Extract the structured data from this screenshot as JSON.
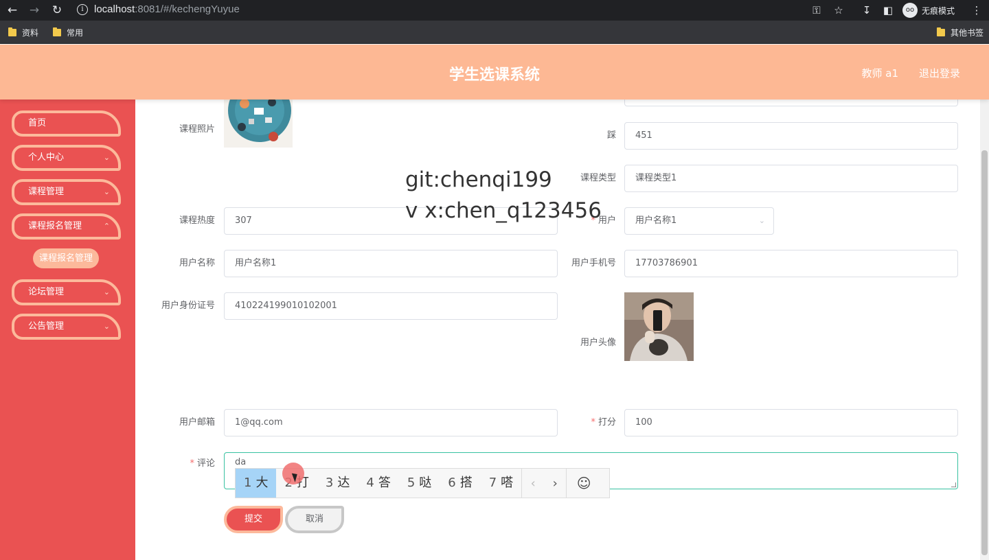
{
  "browser": {
    "url_host": "localhost",
    "url_rest": ":8081/#/kechengYuyue",
    "incognito_label": "无痕模式",
    "bookmarks": [
      {
        "label": "资料"
      },
      {
        "label": "常用"
      }
    ],
    "other_bookmarks": "其他书签"
  },
  "header": {
    "title": "学生选课系统",
    "user": "教师 a1",
    "logout": "退出登录",
    "bg_color": "#fdb894"
  },
  "sidebar": {
    "bg_color": "#ea5252",
    "items": [
      {
        "label": "首页",
        "has_arrow": false
      },
      {
        "label": "个人中心",
        "has_arrow": true
      },
      {
        "label": "课程管理",
        "has_arrow": true
      },
      {
        "label": "课程报名管理",
        "has_arrow": true
      },
      {
        "label": "论坛管理",
        "has_arrow": true
      },
      {
        "label": "公告管理",
        "has_arrow": true
      }
    ],
    "active_sub": "课程报名管理"
  },
  "form": {
    "course_photo_label": "课程照片",
    "cai_label": "踩",
    "cai_value": "451",
    "course_type_label": "课程类型",
    "course_type_value": "课程类型1",
    "heat_label": "课程热度",
    "heat_value": "307",
    "user_label": "用户",
    "user_value": "用户名称1",
    "username_label": "用户名称",
    "username_value": "用户名称1",
    "phone_label": "用户手机号",
    "phone_value": "17703786901",
    "idcard_label": "用户身份证号",
    "idcard_value": "410224199010102001",
    "avatar_label": "用户头像",
    "email_label": "用户邮箱",
    "email_value": "1@qq.com",
    "score_label": "打分",
    "score_value": "100",
    "comment_label": "评论",
    "comment_value": "da",
    "submit": "提交",
    "cancel": "取消"
  },
  "watermark": {
    "line1": "git:chenqi199",
    "line2": "v x:chen_q123456"
  },
  "ime": {
    "candidates": [
      {
        "num": "1",
        "text": "大"
      },
      {
        "num": "2",
        "text": "打"
      },
      {
        "num": "3",
        "text": "达"
      },
      {
        "num": "4",
        "text": "答"
      },
      {
        "num": "5",
        "text": "哒"
      },
      {
        "num": "6",
        "text": "搭"
      },
      {
        "num": "7",
        "text": "嗒"
      }
    ]
  }
}
